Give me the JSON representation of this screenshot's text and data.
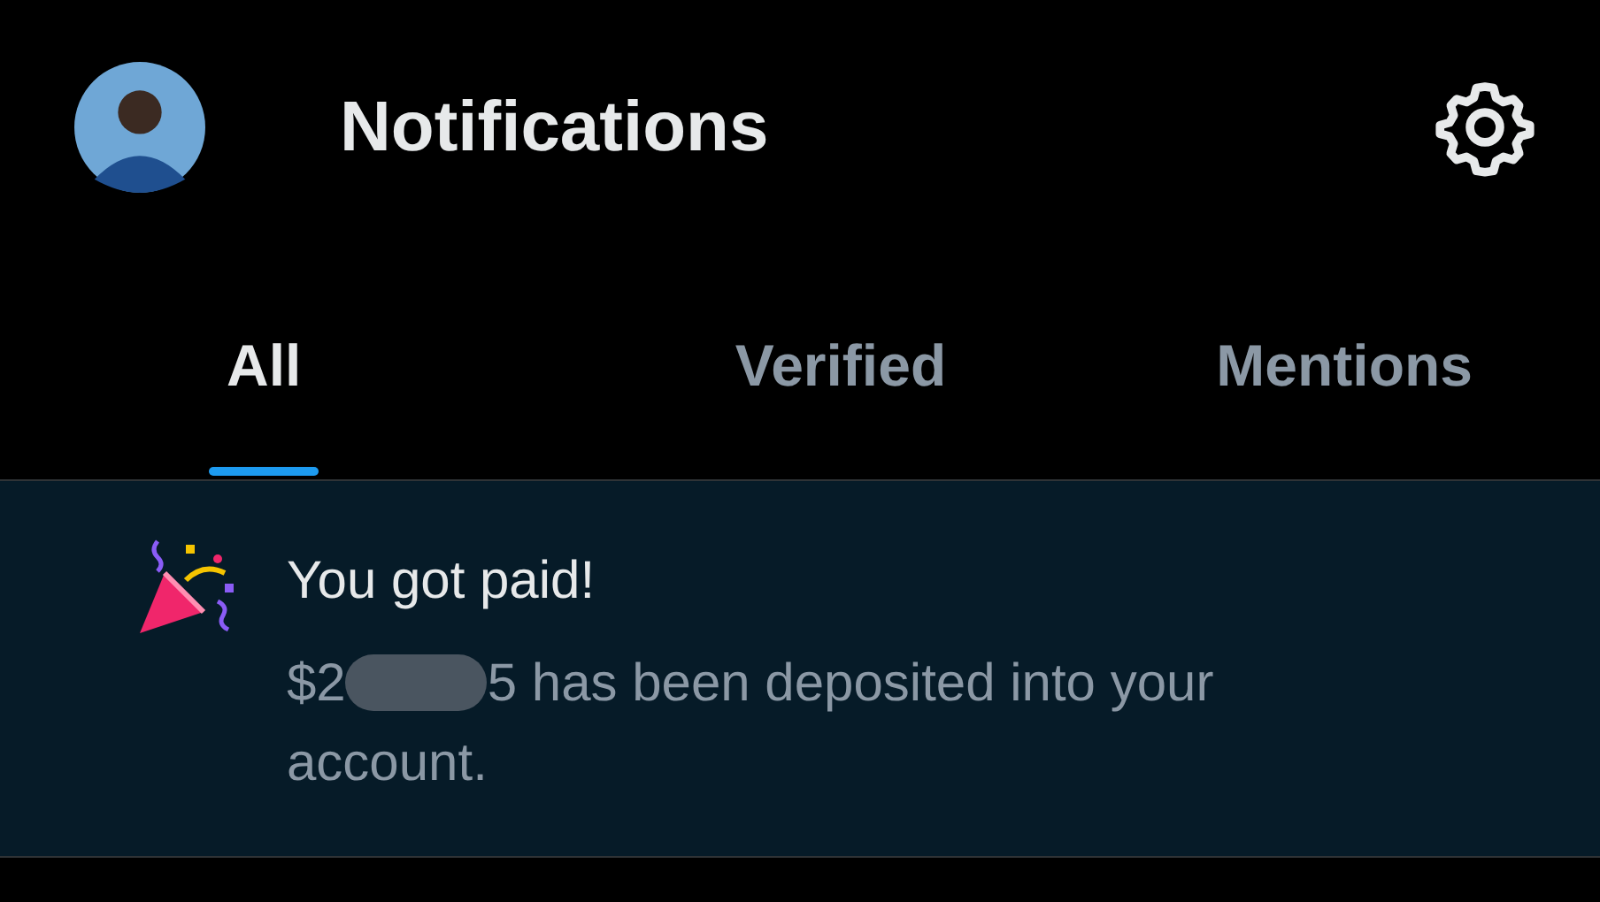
{
  "header": {
    "title": "Notifications"
  },
  "tabs": [
    {
      "label": "All",
      "selected": true
    },
    {
      "label": "Verified",
      "selected": false
    },
    {
      "label": "Mentions",
      "selected": false
    }
  ],
  "notifications": [
    {
      "title": "You got paid!",
      "amount_start": "$2",
      "amount_redacted": true,
      "body": "5 has been deposited into your account.",
      "unread": true
    }
  ]
}
